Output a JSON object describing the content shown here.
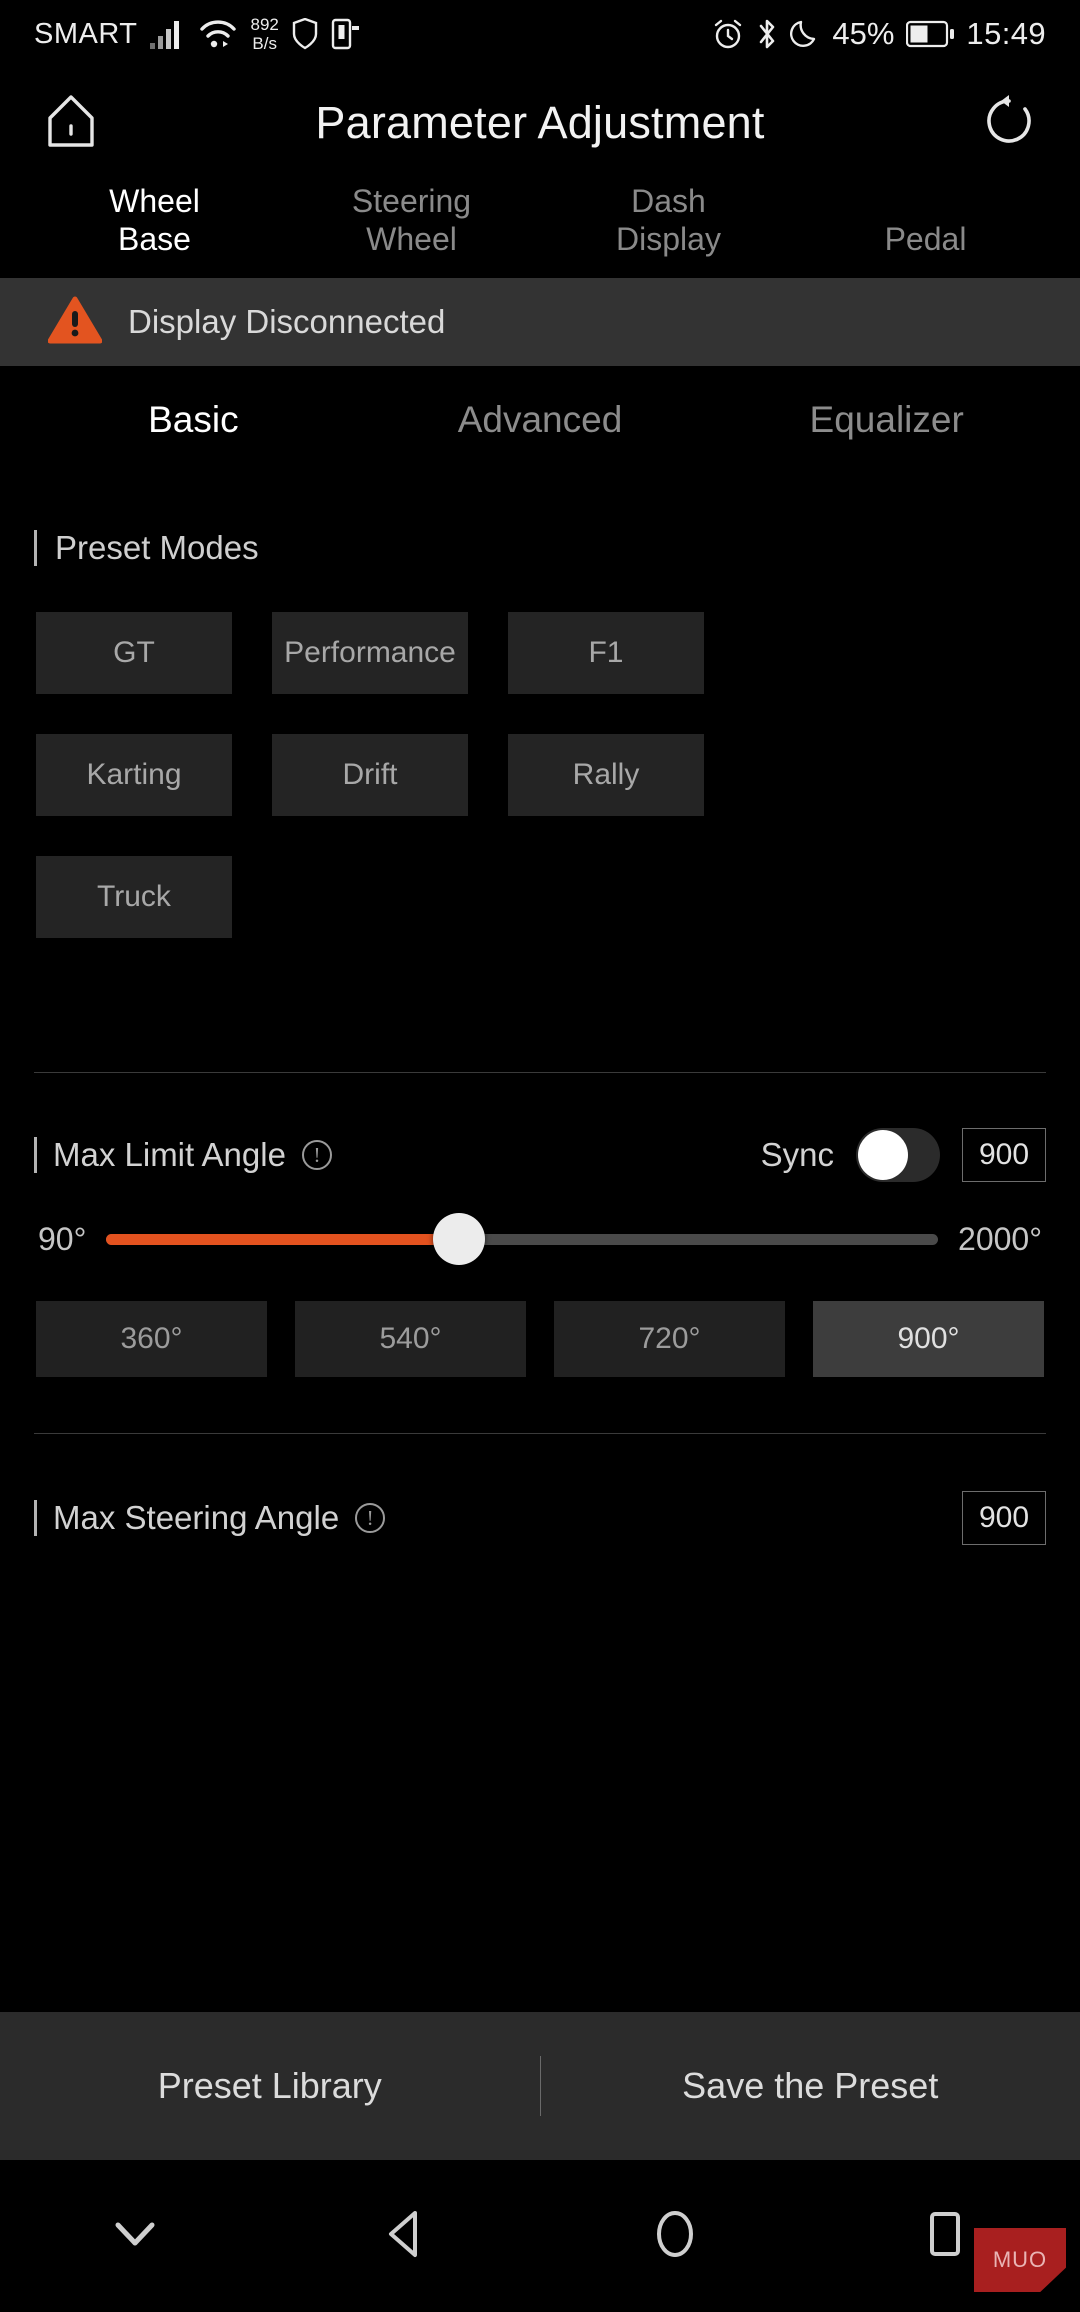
{
  "statusbar": {
    "carrier": "SMART",
    "data_rate_value": "892",
    "data_rate_unit": "B/s",
    "battery_percent": "45%",
    "clock": "15:49",
    "icons": [
      "signal-bars-icon",
      "wifi-icon",
      "shield-icon",
      "sim-card-icon",
      "alarm-icon",
      "bluetooth-icon",
      "do-not-disturb-moon-icon",
      "battery-icon"
    ]
  },
  "header": {
    "title": "Parameter Adjustment",
    "home_icon": "home-icon",
    "reset_icon": "reset-icon"
  },
  "main_tabs": [
    {
      "label_line1": "Wheel",
      "label_line2": "Base",
      "active": true
    },
    {
      "label_line1": "Steering",
      "label_line2": "Wheel",
      "active": false
    },
    {
      "label_line1": "Dash",
      "label_line2": "Display",
      "active": false
    },
    {
      "label_line1": "Pedal",
      "label_line2": "",
      "active": false
    }
  ],
  "warning": {
    "icon": "warning-triangle-icon",
    "text": "Display Disconnected",
    "color": "#e35420",
    "bg": "#333333"
  },
  "sub_tabs": [
    {
      "label": "Basic",
      "active": true
    },
    {
      "label": "Advanced",
      "active": false
    },
    {
      "label": "Equalizer",
      "active": false
    }
  ],
  "preset_modes": {
    "title": "Preset Modes",
    "items": [
      {
        "label": "GT"
      },
      {
        "label": "Performance"
      },
      {
        "label": "F1"
      },
      {
        "label": "Karting"
      },
      {
        "label": "Drift"
      },
      {
        "label": "Rally"
      },
      {
        "label": "Truck"
      }
    ]
  },
  "max_limit_angle": {
    "title": "Max Limit Angle",
    "info_icon": "info-icon",
    "sync_label": "Sync",
    "sync_on": false,
    "value": "900",
    "slider": {
      "min_label": "90°",
      "max_label": "2000°",
      "min": 90,
      "max": 2000,
      "value": 900,
      "fill_color": "#e3521f",
      "track_color": "#4a4a4a"
    },
    "quick_values": [
      {
        "label": "360°",
        "selected": false
      },
      {
        "label": "540°",
        "selected": false
      },
      {
        "label": "720°",
        "selected": false
      },
      {
        "label": "900°",
        "selected": true
      }
    ]
  },
  "max_steering_angle": {
    "title": "Max Steering Angle",
    "info_icon": "info-icon",
    "value": "900"
  },
  "action_bar": {
    "preset_library": "Preset Library",
    "save_preset": "Save the Preset"
  },
  "navbar": {
    "icons": [
      "chevron-down-icon",
      "back-triangle-icon",
      "home-circle-icon",
      "recents-square-icon"
    ],
    "watermark": "MUO"
  }
}
